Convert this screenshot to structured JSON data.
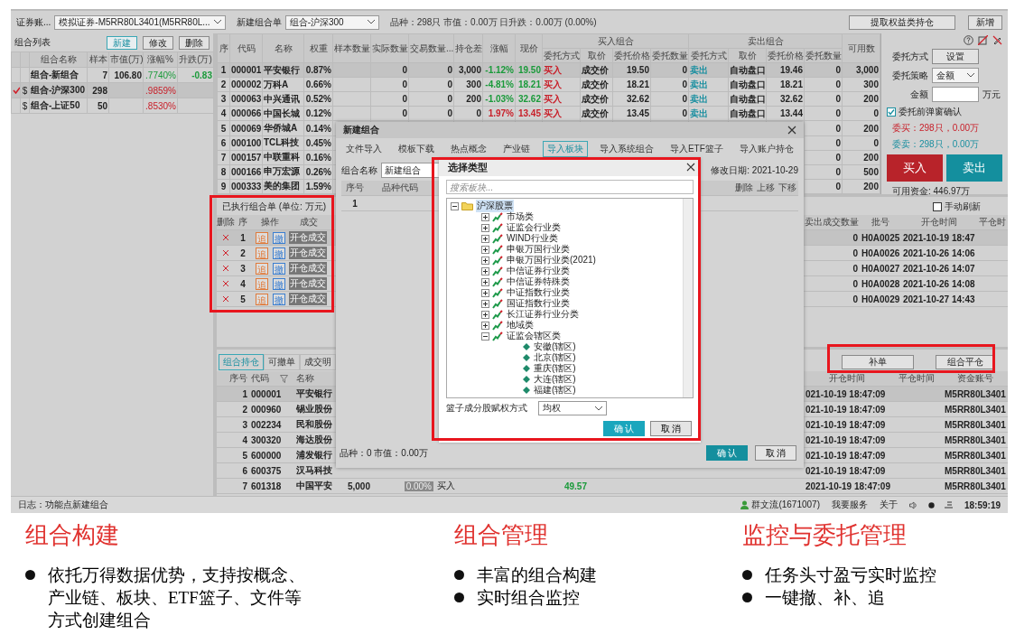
{
  "toolbar": {
    "account_label": "证券账...",
    "account": "模拟证券-M5RR80L3401(M5RR80L...",
    "order_label": "新建组合单",
    "combo": "组合-沪深300",
    "stats": "品种：298只  市值：0.00万  日升跌：0.00万  (0.00%)",
    "buttons": [
      "提取权益类持仓",
      "新增"
    ]
  },
  "combo_list": {
    "title": "组合列表",
    "buttons": [
      {
        "label": "新建",
        "selected": true
      },
      {
        "label": "修改",
        "selected": false
      },
      {
        "label": "删除",
        "selected": false
      }
    ],
    "columns": [
      "组合名称",
      "样本",
      "市值(万)",
      "涨幅%",
      "升跌(万)"
    ],
    "rows": [
      {
        "selected": false,
        "name": "组合-新组合",
        "samples": "7",
        "value": "106.80",
        "change": ".7740%",
        "up": false,
        "rise": "-0.83"
      },
      {
        "selected": true,
        "marker": "$",
        "name": "组合-沪深300",
        "samples": "298",
        "change": ".9859%",
        "up": true
      },
      {
        "selected": false,
        "marker": "$",
        "name": "组合-上证50",
        "samples": "50",
        "change": ".8530%",
        "up": true
      }
    ]
  },
  "main_table": {
    "columns": [
      "序",
      "代码",
      "名称",
      "权重",
      "样本数量",
      "实际数量",
      "交易数量...",
      "持仓差",
      "涨幅",
      "现价"
    ],
    "buy_group": {
      "title": "买入组合",
      "columns": [
        "委托方式",
        "取价",
        "委托价格",
        "委托数量"
      ]
    },
    "sell_group": {
      "title": "卖出组合",
      "columns": [
        "委托方式",
        "取价",
        "委托价格",
        "委托数量"
      ]
    },
    "last_column": "可用数",
    "rows": [
      {
        "selected": true,
        "seq": "1",
        "code": "000001",
        "name": "平安银行",
        "weight": "0.87%",
        "actual": "0",
        "trade": "0",
        "diff": "3,000",
        "change": "-1.12%",
        "up": false,
        "price": "19.50",
        "buy_mode": "买入",
        "buy_price_type": "成交价",
        "buy_price": "19.50",
        "buy_qty": "0",
        "sell_mode": "卖出",
        "sell_price_type": "自动盘口",
        "sell_price": "19.46",
        "sell_qty": "0",
        "available": "3,000"
      },
      {
        "selected": false,
        "seq": "2",
        "code": "000002",
        "name": "万科A",
        "weight": "0.66%",
        "actual": "0",
        "trade": "0",
        "diff": "300",
        "change": "-4.81%",
        "up": false,
        "price": "18.21",
        "buy_mode": "买入",
        "buy_price_type": "成交价",
        "buy_price": "18.21",
        "buy_qty": "0",
        "sell_mode": "卖出",
        "sell_price_type": "自动盘口",
        "sell_price": "18.21",
        "sell_qty": "0",
        "available": "300"
      },
      {
        "selected": false,
        "seq": "3",
        "code": "000063",
        "name": "中兴通讯",
        "weight": "0.52%",
        "actual": "0",
        "trade": "0",
        "diff": "200",
        "change": "-1.03%",
        "up": false,
        "price": "32.62",
        "buy_mode": "买入",
        "buy_price_type": "成交价",
        "buy_price": "32.62",
        "buy_qty": "0",
        "sell_mode": "卖出",
        "sell_price_type": "自动盘口",
        "sell_price": "32.62",
        "sell_qty": "0",
        "available": "200"
      },
      {
        "selected": false,
        "seq": "4",
        "code": "000066",
        "name": "中国长城",
        "weight": "0.12%",
        "actual": "0",
        "trade": "0",
        "diff": "0",
        "change": "1.97%",
        "up": true,
        "price": "13.45",
        "buy_mode": "买入",
        "buy_price_type": "成交价",
        "buy_price": "13.45",
        "buy_qty": "0",
        "sell_mode": "卖出",
        "sell_price_type": "自动盘口",
        "sell_price": "13.44",
        "sell_qty": "0",
        "available": "0"
      },
      {
        "selected": false,
        "seq": "5",
        "code": "000069",
        "name": "华侨城A",
        "weight": "0.14%",
        "sell_qty": "0",
        "available": "200"
      },
      {
        "selected": false,
        "seq": "6",
        "code": "000100",
        "name": "TCL科技",
        "weight": "0.45%",
        "sell_qty": "0",
        "available": "0"
      },
      {
        "selected": false,
        "seq": "7",
        "code": "000157",
        "name": "中联重科",
        "weight": "0.16%",
        "sell_qty": "0",
        "available": "200"
      },
      {
        "selected": false,
        "seq": "8",
        "code": "000166",
        "name": "申万宏源",
        "weight": "0.26%",
        "sell_qty": "0",
        "available": "500"
      },
      {
        "selected": false,
        "seq": "9",
        "code": "000333",
        "name": "美的集团",
        "weight": "1.59%",
        "sell_qty": "0",
        "available": "200"
      }
    ]
  },
  "order_panel": {
    "mode_label": "委托方式",
    "mode_button": "设置",
    "strategy_label": "委托策略",
    "strategy": "金额",
    "amount_label": "金额",
    "amount_unit": "万元",
    "confirm": {
      "label": "委托前弹窗确认",
      "checked": true
    },
    "buy_summary": "委买：298只，0.00万",
    "sell_summary": "委卖：298只，0.00万",
    "buy_button": "买入",
    "sell_button": "卖出",
    "funds": "可用资金: 446.97万"
  },
  "executed": {
    "title": "已执行组合单  (单位: 万元)",
    "refresh": {
      "label": "手动刷新",
      "checked": false
    },
    "left_columns": [
      "删除",
      "序",
      "操作",
      "成交"
    ],
    "right_columns": [
      "卖出成交数量",
      "批号",
      "开仓时间",
      "平仓时"
    ],
    "rows": [
      {
        "selected": true,
        "seq": "1",
        "chase": "追",
        "cancel": "撤",
        "status": "开仓成交",
        "sell_qty": "0",
        "batch": "H0A0025",
        "open_time": "2021-10-19 18:47"
      },
      {
        "selected": false,
        "seq": "2",
        "chase": "追",
        "cancel": "撤",
        "status": "开仓成交",
        "sell_qty": "0",
        "batch": "H0A0026",
        "open_time": "2021-10-26 14:06"
      },
      {
        "selected": false,
        "seq": "3",
        "chase": "追",
        "cancel": "撤",
        "status": "开仓成交",
        "sell_qty": "0",
        "batch": "H0A0027",
        "open_time": "2021-10-26 14:07"
      },
      {
        "selected": false,
        "seq": "4",
        "chase": "追",
        "cancel": "撤",
        "status": "开仓成交",
        "sell_qty": "0",
        "batch": "H0A0028",
        "open_time": "2021-10-26 14:08"
      },
      {
        "selected": false,
        "seq": "5",
        "chase": "追",
        "cancel": "撤",
        "status": "开仓成交",
        "sell_qty": "0",
        "batch": "H0A0029",
        "open_time": "2021-10-27 14:43"
      }
    ]
  },
  "positions": {
    "tabs": [
      {
        "label": "组合持仓",
        "selected": true
      },
      {
        "label": "可撤单",
        "selected": false
      },
      {
        "label": "成交明",
        "selected": false
      }
    ],
    "buttons": [
      "补单",
      "组合平仓"
    ],
    "left_columns": [
      "序号",
      "代码",
      "名称"
    ],
    "right_columns": [
      "开仓时间",
      "平仓时间",
      "资金账号"
    ],
    "rows": [
      {
        "selected": true,
        "seq": "1",
        "code": "000001",
        "name": "平安银行",
        "open_time": "021-10-19 18:47:09",
        "account": "M5RR80L3401"
      },
      {
        "selected": false,
        "seq": "2",
        "code": "000960",
        "name": "锡业股份",
        "open_time": "021-10-19 18:47:09",
        "account": "M5RR80L3401"
      },
      {
        "selected": false,
        "seq": "3",
        "code": "002234",
        "name": "民和股份",
        "open_time": "021-10-19 18:47:09",
        "account": "M5RR80L3401"
      },
      {
        "selected": false,
        "seq": "4",
        "code": "300320",
        "name": "海达股份",
        "open_time": "021-10-19 18:47:09",
        "account": "M5RR80L3401"
      },
      {
        "selected": false,
        "seq": "5",
        "code": "600000",
        "name": "浦发银行",
        "open_time": "021-10-19 18:47:09",
        "account": "M5RR80L3401"
      },
      {
        "selected": false,
        "seq": "6",
        "code": "600375",
        "name": "汉马科技",
        "open_time": "021-10-19 18:47:09",
        "account": "M5RR80L3401"
      },
      {
        "selected": false,
        "seq": "7",
        "code": "601318",
        "name": "中国平安",
        "qty": "5,000",
        "badge": "0.00%",
        "side": "买入",
        "price": "49.57",
        "open_time": "2021-10-19 18:47:09",
        "account": "M5RR80L3401"
      }
    ]
  },
  "status_bar": {
    "log": "日志：功能点新建组合",
    "user": "群文流(1671007)",
    "service": "我要服务",
    "about": "关于",
    "time": "18:59:19"
  },
  "new_combo_dialog": {
    "title": "新建组合",
    "tabs": [
      {
        "label": "文件导入",
        "selected": false
      },
      {
        "label": "模板下载",
        "selected": false
      },
      {
        "label": "热点概念",
        "selected": false
      },
      {
        "label": "产业链",
        "selected": false
      },
      {
        "label": "导入板块",
        "selected": true
      },
      {
        "label": "导入系统组合",
        "selected": false
      },
      {
        "label": "导入ETF篮子",
        "selected": false
      },
      {
        "label": "导入账户持仓",
        "selected": false
      }
    ],
    "name_label": "组合名称",
    "name_value": "新建组合",
    "date": "修改日期: 2021-10-29",
    "left_columns": [
      "序号",
      "品种代码"
    ],
    "right_columns": [
      "删除",
      "上移",
      "下移"
    ],
    "rows": [
      {
        "seq": "1"
      }
    ],
    "summary": "品种：0  市值：0.00万",
    "buttons": [
      {
        "label": "确 认",
        "primary": true
      },
      {
        "label": "取 消",
        "primary": false
      }
    ]
  },
  "select_dialog": {
    "title": "选择类型",
    "search_placeholder": "搜索板块...",
    "tree": [
      {
        "label": "沪深股票",
        "kind": "folder",
        "selected": true,
        "expanded": true,
        "children": [
          {
            "label": "市场类",
            "kind": "category",
            "selected": false,
            "expanded": false
          },
          {
            "label": "证监会行业类",
            "kind": "category",
            "selected": false,
            "expanded": false
          },
          {
            "label": "WIND行业类",
            "kind": "category",
            "selected": false,
            "expanded": false
          },
          {
            "label": "申银万国行业类",
            "kind": "category",
            "selected": false,
            "expanded": false
          },
          {
            "label": "申银万国行业类(2021)",
            "kind": "category",
            "selected": false,
            "expanded": false
          },
          {
            "label": "中信证券行业类",
            "kind": "category",
            "selected": false,
            "expanded": false
          },
          {
            "label": "中信证券特殊类",
            "kind": "category",
            "selected": false,
            "expanded": false
          },
          {
            "label": "中证指数行业类",
            "kind": "category",
            "selected": false,
            "expanded": false
          },
          {
            "label": "国证指数行业类",
            "kind": "category",
            "selected": false,
            "expanded": false
          },
          {
            "label": "长江证券行业分类",
            "kind": "category",
            "selected": false,
            "expanded": false
          },
          {
            "label": "地域类",
            "kind": "category",
            "selected": false,
            "expanded": false
          },
          {
            "label": "证监会辖区类",
            "kind": "category",
            "selected": false,
            "expanded": true,
            "children": [
              {
                "label": "安徽(辖区)",
                "kind": "region",
                "selected": false
              },
              {
                "label": "北京(辖区)",
                "kind": "region",
                "selected": false
              },
              {
                "label": "重庆(辖区)",
                "kind": "region",
                "selected": false
              },
              {
                "label": "大连(辖区)",
                "kind": "region",
                "selected": false
              },
              {
                "label": "福建(辖区)",
                "kind": "region",
                "selected": false
              }
            ]
          }
        ]
      }
    ],
    "weight_label": "篮子成分股赋权方式",
    "weight_value": "均权",
    "buttons": [
      {
        "label": "确 认",
        "primary": true
      },
      {
        "label": "取 消",
        "primary": false
      }
    ]
  },
  "slide": {
    "sections": [
      {
        "heading": "组合构建",
        "bullets": [
          "依托万得数据优势，支持按概念、产业链、板块、ETF篮子、文件等方式创建组合"
        ]
      },
      {
        "heading": "组合管理",
        "bullets": [
          "丰富的组合构建",
          "实时组合监控"
        ]
      },
      {
        "heading": "监控与委托管理",
        "bullets": [
          "任务头寸盈亏实时监控",
          "一键撤、补、追"
        ]
      }
    ]
  }
}
